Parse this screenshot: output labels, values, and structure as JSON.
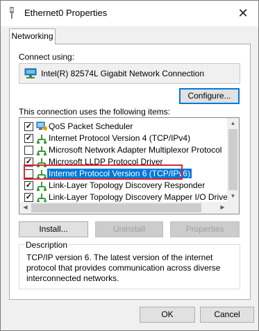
{
  "window": {
    "title": "Ethernet0 Properties",
    "close_glyph": "✕"
  },
  "tabs": [
    {
      "label": "Networking"
    }
  ],
  "connect_using_label": "Connect using:",
  "adapter_name": "Intel(R) 82574L Gigabit Network Connection",
  "configure_label": "Configure...",
  "items_label": "This connection uses the following items:",
  "items": [
    {
      "label": "QoS Packet Scheduler",
      "checked": true,
      "icon": "qos-scheduler-icon"
    },
    {
      "label": "Internet Protocol Version 4 (TCP/IPv4)",
      "checked": true,
      "icon": "protocol-icon"
    },
    {
      "label": "Microsoft Network Adapter Multiplexor Protocol",
      "checked": false,
      "icon": "protocol-icon"
    },
    {
      "label": "Microsoft LLDP Protocol Driver",
      "checked": true,
      "icon": "protocol-icon"
    },
    {
      "label": "Internet Protocol Version 6 (TCP/IPv6)",
      "checked": false,
      "icon": "protocol-icon",
      "selected": true
    },
    {
      "label": "Link-Layer Topology Discovery Responder",
      "checked": true,
      "icon": "protocol-icon"
    },
    {
      "label": "Link-Layer Topology Discovery Mapper I/O Driver",
      "checked": true,
      "icon": "protocol-icon"
    }
  ],
  "buttons": {
    "install": "Install...",
    "uninstall": "Uninstall",
    "properties": "Properties"
  },
  "description": {
    "legend": "Description",
    "text": "TCP/IP version 6. The latest version of the internet protocol that provides communication across diverse interconnected networks."
  },
  "dialog_buttons": {
    "ok": "OK",
    "cancel": "Cancel"
  },
  "colors": {
    "accent": "#0078d7",
    "highlight_box": "#e0262c"
  }
}
